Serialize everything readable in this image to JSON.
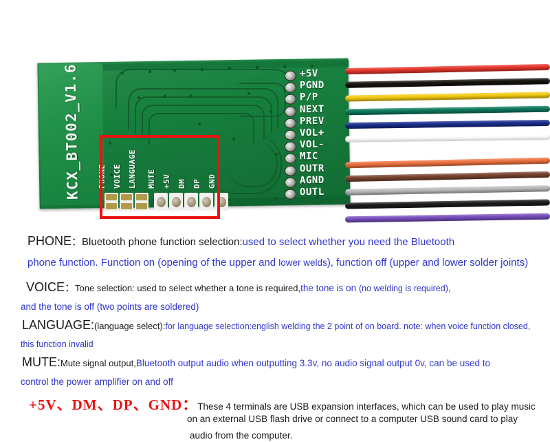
{
  "board": {
    "name": "KCX_BT002_V1.6",
    "right_pins": [
      "+5V",
      "PGND",
      "P/P",
      "NEXT",
      "PREV",
      "VOL+",
      "VOL-",
      "MIC",
      "OUTR",
      "AGND",
      "OUTL"
    ],
    "bottom_pads": [
      {
        "label": "PHONE",
        "type": "jumper"
      },
      {
        "label": "VOICE",
        "type": "jumper"
      },
      {
        "label": "LANGUAGE",
        "type": "jumper"
      },
      {
        "label": "MUTE",
        "type": "round"
      },
      {
        "label": "+5V",
        "type": "round"
      },
      {
        "label": "DM",
        "type": "round"
      },
      {
        "label": "DP",
        "type": "round"
      },
      {
        "label": "GND",
        "type": "round"
      }
    ],
    "wire_colors": [
      "#e8372c",
      "#17140f",
      "#f5cb11",
      "#0e7a5f",
      "#1b2f8f",
      "#fdfdfd",
      "#ef7340",
      "#7a4530",
      "#b9bbbd",
      "#1c1c1c",
      "#7a4fc0"
    ],
    "highlight_color": "#ee1111"
  },
  "notes": {
    "phone": {
      "label": "PHONE",
      "sep": "：",
      "black": "Bluetooth phone function selection:",
      "blue1": "used to select whether you need the Bluetooth",
      "blue2a": "phone function. Function on (opening of the upper and ",
      "blue2b": "lower welds",
      "blue2c": "), function off (upper and lower solder joints)"
    },
    "voice": {
      "label": "VOICE",
      "sep": "：",
      "black": "Tone selection: used to select whether a tone is required,",
      "blue1": "the tone is on ",
      "blue1b": "(no welding is required),",
      "blue2": "and the tone is off (two points are soldered)"
    },
    "language": {
      "label": "LANGUAGE:",
      "black": "(language select):",
      "blue1": "for language selection:english welding the 2 point of on board. note: when voice function closed,",
      "blue2": "this function invalid"
    },
    "mute": {
      "label": "MUTE:",
      "black": "Mute signal output,",
      "blue1": "Bluetooth output audio when outputting 3.3v, no audio signal output 0v, can be used to",
      "blue2": "control the power amplifier on and off"
    },
    "usb": {
      "heading": "+5V、DM、DP、GND：",
      "line1": "These 4 terminals are USB expansion interfaces, which can be used to play music",
      "line2": "on an external USB flash drive or connect to a computer USB sound card to play",
      "line3": "audio from the computer."
    }
  }
}
